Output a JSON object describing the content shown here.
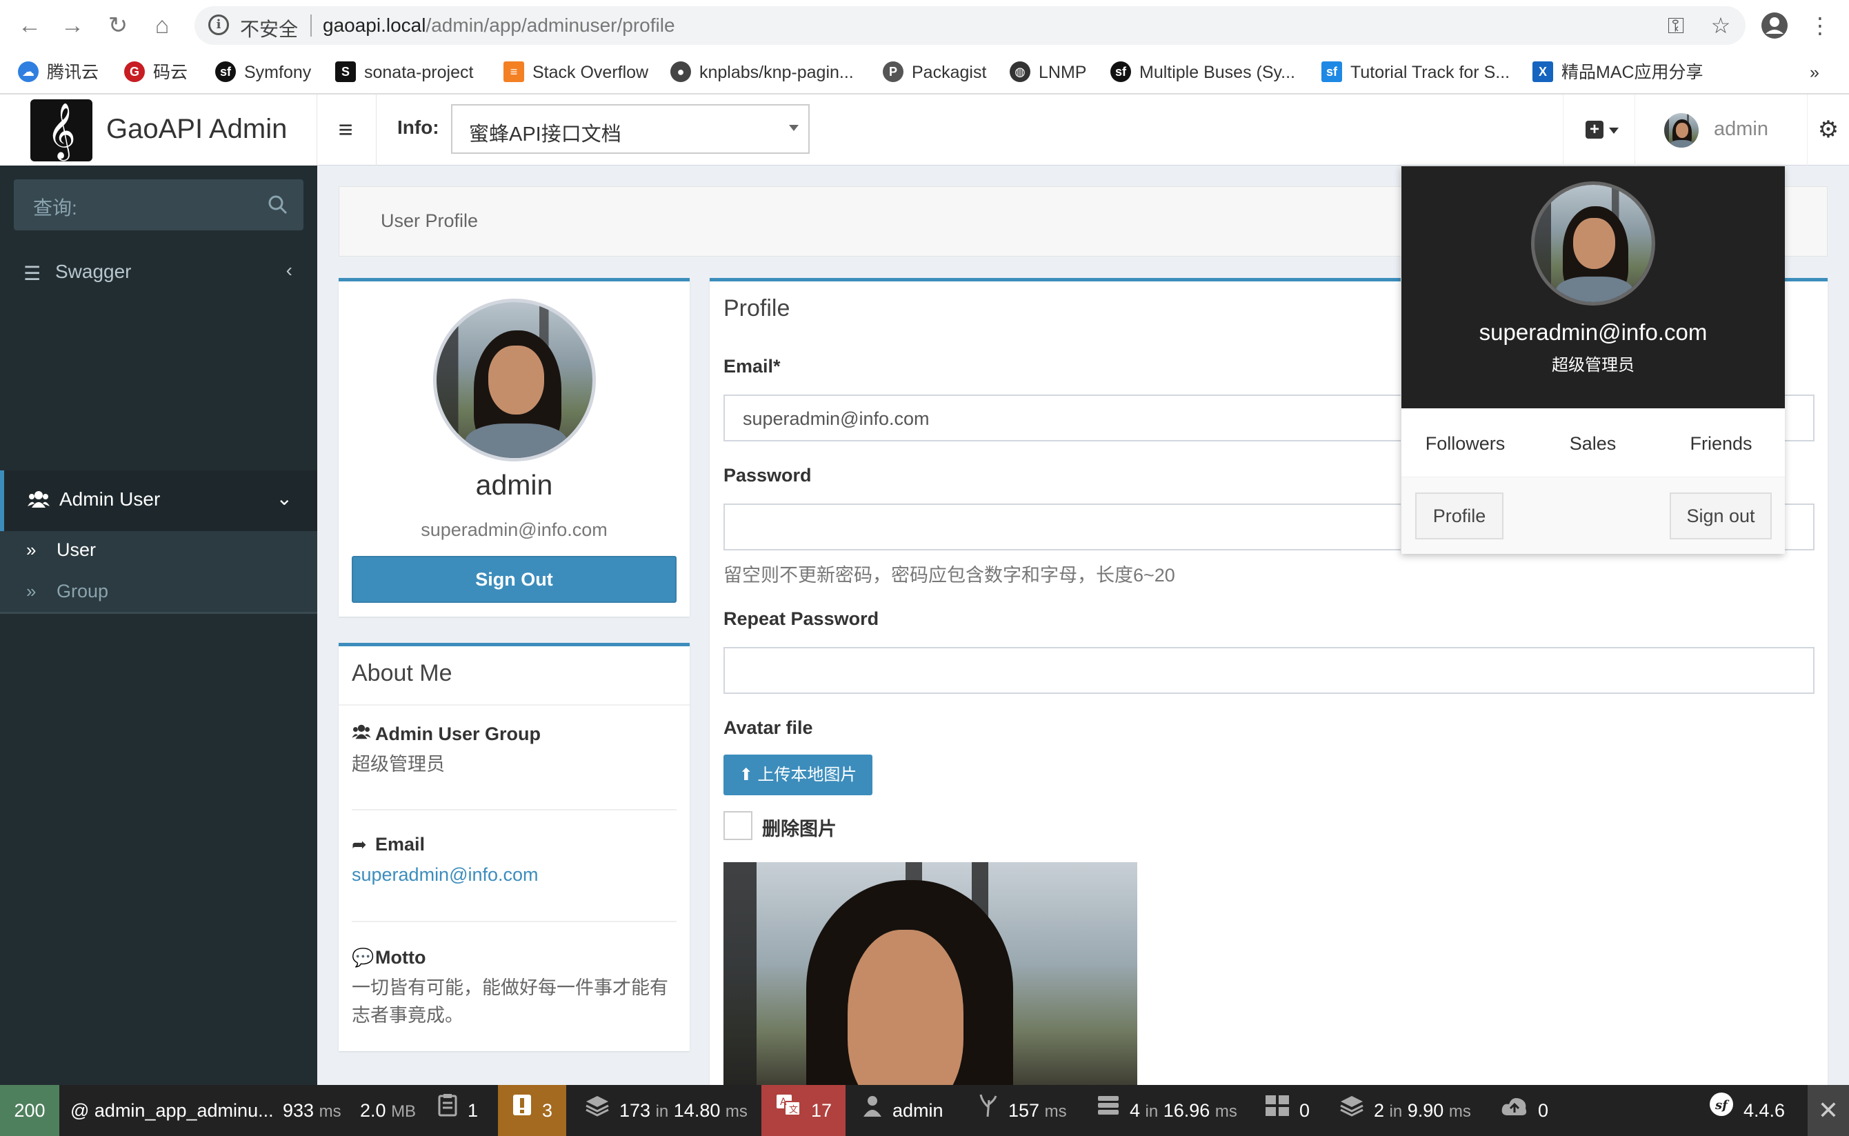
{
  "browser": {
    "insecure_label": "不安全",
    "url_host": "gaoapi.local",
    "url_path": "/admin/app/adminuser/profile",
    "bookmarks": [
      {
        "label": "腾讯云",
        "icon": "cloud-icon",
        "color": "#2f7fe0"
      },
      {
        "label": "码云",
        "icon": "gitee-icon",
        "color": "#c71d23"
      },
      {
        "label": "Symfony",
        "icon": "symfony-icon",
        "color": "#111111"
      },
      {
        "label": "sonata-project",
        "icon": "sonata-icon",
        "color": "#111111"
      },
      {
        "label": "Stack Overflow",
        "icon": "stackoverflow-icon",
        "color": "#f48024"
      },
      {
        "label": "knplabs/knp-pagin...",
        "icon": "github-icon",
        "color": "#444444"
      },
      {
        "label": "Packagist",
        "icon": "packagist-icon",
        "color": "#555555"
      },
      {
        "label": "LNMP",
        "icon": "globe-icon",
        "color": "#333333"
      },
      {
        "label": "Multiple Buses (Sy...",
        "icon": "symfony-icon",
        "color": "#111111"
      },
      {
        "label": "Tutorial Track for S...",
        "icon": "symfonycasts-icon",
        "color": "#1e88e5"
      },
      {
        "label": "精品MAC应用分享",
        "icon": "x-icon",
        "color": "#1565c0"
      }
    ],
    "more": "»"
  },
  "header": {
    "logo_text": "GaoAPI Admin",
    "info_label": "Info:",
    "info_select_value": "蜜蜂API接口文档",
    "user_name": "admin"
  },
  "sidebar": {
    "search_placeholder": "查询:",
    "items": [
      {
        "label": "Swagger",
        "icon": "list-icon",
        "arrow": "‹"
      },
      {
        "label": "Admin User",
        "icon": "users-icon",
        "arrow": "⌄"
      }
    ],
    "subitems": [
      {
        "label": "User",
        "icon": "double-chevron-icon",
        "active": true
      },
      {
        "label": "Group",
        "icon": "double-chevron-icon",
        "active": false
      }
    ]
  },
  "breadcrumb": "User Profile",
  "profile_card": {
    "name": "admin",
    "email": "superadmin@info.com",
    "signout_label": "Sign Out"
  },
  "about": {
    "title": "About Me",
    "group_label": "Admin User Group",
    "group_value": "超级管理员",
    "email_label": "Email",
    "email_value": "superadmin@info.com",
    "motto_label": "Motto",
    "motto_value": "一切皆有可能，能做好每一件事才能有志者事竟成。"
  },
  "form": {
    "title": "Profile",
    "email_label": "Email*",
    "email_value": "superadmin@info.com",
    "password_label": "Password",
    "password_value": "",
    "password_help": "留空则不更新密码，密码应包含数字和字母，长度6~20",
    "repeat_label": "Repeat Password",
    "repeat_value": "",
    "avatar_label": "Avatar file",
    "upload_label": "上传本地图片",
    "delete_label": "删除图片"
  },
  "dropdown": {
    "email": "superadmin@info.com",
    "role": "超级管理员",
    "links": [
      "Followers",
      "Sales",
      "Friends"
    ],
    "profile_btn": "Profile",
    "signout_btn": "Sign out"
  },
  "toolbar": {
    "status": "200",
    "route": "@ admin_app_adminu...",
    "time_value": "933",
    "time_unit": "ms",
    "memory_value": "2.0",
    "memory_unit": "MB",
    "forms_count": "1",
    "logs_count": "3",
    "cache_value": "173",
    "cache_in": "in",
    "cache_time": "14.80",
    "cache_unit": "ms",
    "translation_count": "17",
    "user": "admin",
    "twig_value": "157",
    "twig_unit": "ms",
    "db_value": "4",
    "db_in": "in",
    "db_time": "16.96",
    "db_unit": "ms",
    "dashboard_count": "0",
    "layers_value": "2",
    "layers_in": "in",
    "layers_time": "9.90",
    "layers_unit": "ms",
    "http_count": "0",
    "version": "4.4.6",
    "colors": {
      "status_ok": "#4f805d",
      "warning": "#a46a1f",
      "error": "#b0413e"
    }
  }
}
